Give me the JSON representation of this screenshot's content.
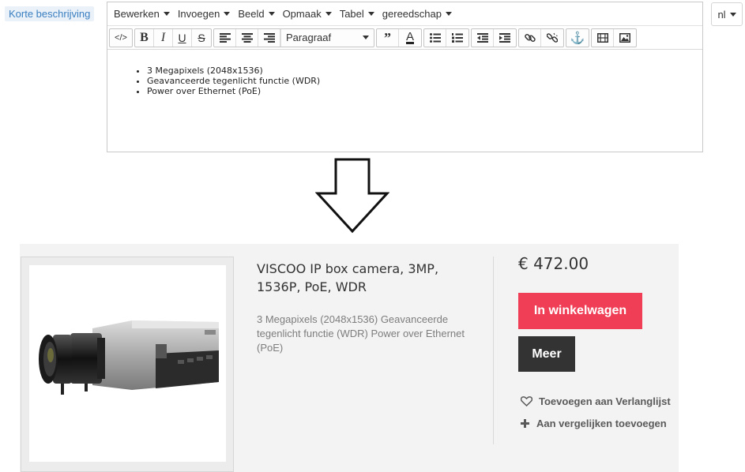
{
  "field": {
    "label": "Korte beschrijving"
  },
  "editor": {
    "menus": [
      "Bewerken",
      "Invoegen",
      "Beeld",
      "Opmaak",
      "Tabel",
      "gereedschap"
    ],
    "format_select": "Paragraaf",
    "content": [
      "3 Megapixels (2048x1536)",
      "Geavanceerde tegenlicht functie (WDR)",
      "Power over Ethernet (PoE)"
    ]
  },
  "lang": {
    "value": "nl"
  },
  "product": {
    "title": "VISCOO IP box camera, 3MP, 1536P, PoE, WDR",
    "description": "3 Megapixels (2048x1536) Geavanceerde tegenlicht functie (WDR) Power over Ethernet (PoE)",
    "price": "€ 472.00",
    "cart_button": "In winkelwagen",
    "more_button": "Meer",
    "wishlist_link": "Toevoegen aan Verlanglijst",
    "compare_link": "Aan vergelijken toevoegen"
  },
  "colors": {
    "accent_red": "#ef3e55",
    "dark_button": "#333333",
    "label_blue": "#3a7fc1"
  },
  "icons": {
    "toolbar": [
      "source-code-icon",
      "bold-icon",
      "italic-icon",
      "underline-icon",
      "strikethrough-icon",
      "align-left-icon",
      "align-center-icon",
      "align-right-icon",
      "blockquote-icon",
      "text-color-icon",
      "bullet-list-icon",
      "numbered-list-icon",
      "outdent-icon",
      "indent-icon",
      "link-icon",
      "unlink-icon",
      "anchor-icon",
      "media-icon",
      "image-icon"
    ],
    "actions": [
      "heart-icon",
      "plus-icon"
    ]
  }
}
